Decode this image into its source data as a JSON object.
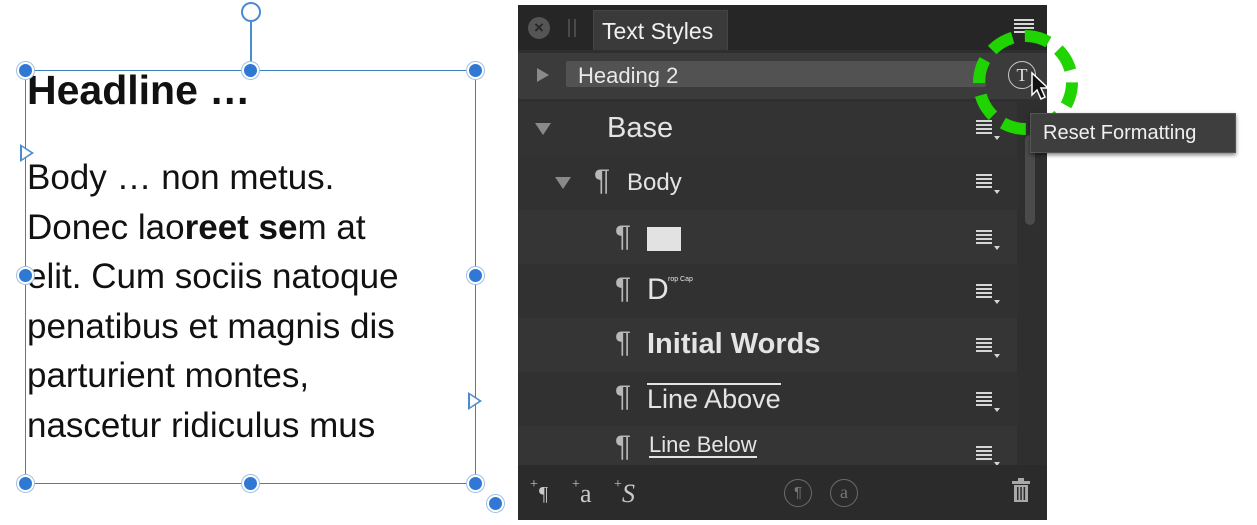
{
  "canvas": {
    "headline": "Headline …",
    "body_lines": {
      "l1": "Body … non metus.",
      "l2_a": "Donec lao",
      "l2_b": "reet se",
      "l2_c": "m at",
      "l3": "elit. Cum sociis natoque",
      "l4": "penatibus et magnis dis",
      "l5": "parturient montes,",
      "l6": "nascetur ridiculus mus"
    }
  },
  "panel": {
    "tab_title": "Text Styles",
    "close_glyph": "×",
    "current_style": "Heading 2",
    "tooltip": "Reset Formatting",
    "styles": {
      "base": "Base",
      "body": "Body",
      "drop_cap_letter": "D",
      "drop_cap_note": "rop Cap",
      "initial_words": "Initial Words",
      "line_above": "Line Above",
      "line_below": "Line Below"
    },
    "pilcrow": "¶",
    "bottom": {
      "new_paragraph": "¶",
      "new_character": "a",
      "new_group": "S",
      "plus": "+"
    }
  },
  "colors": {
    "highlight_ring": "#1fd400",
    "selection_blue": "#2f78d4",
    "panel_bg": "#2f2f2f"
  }
}
